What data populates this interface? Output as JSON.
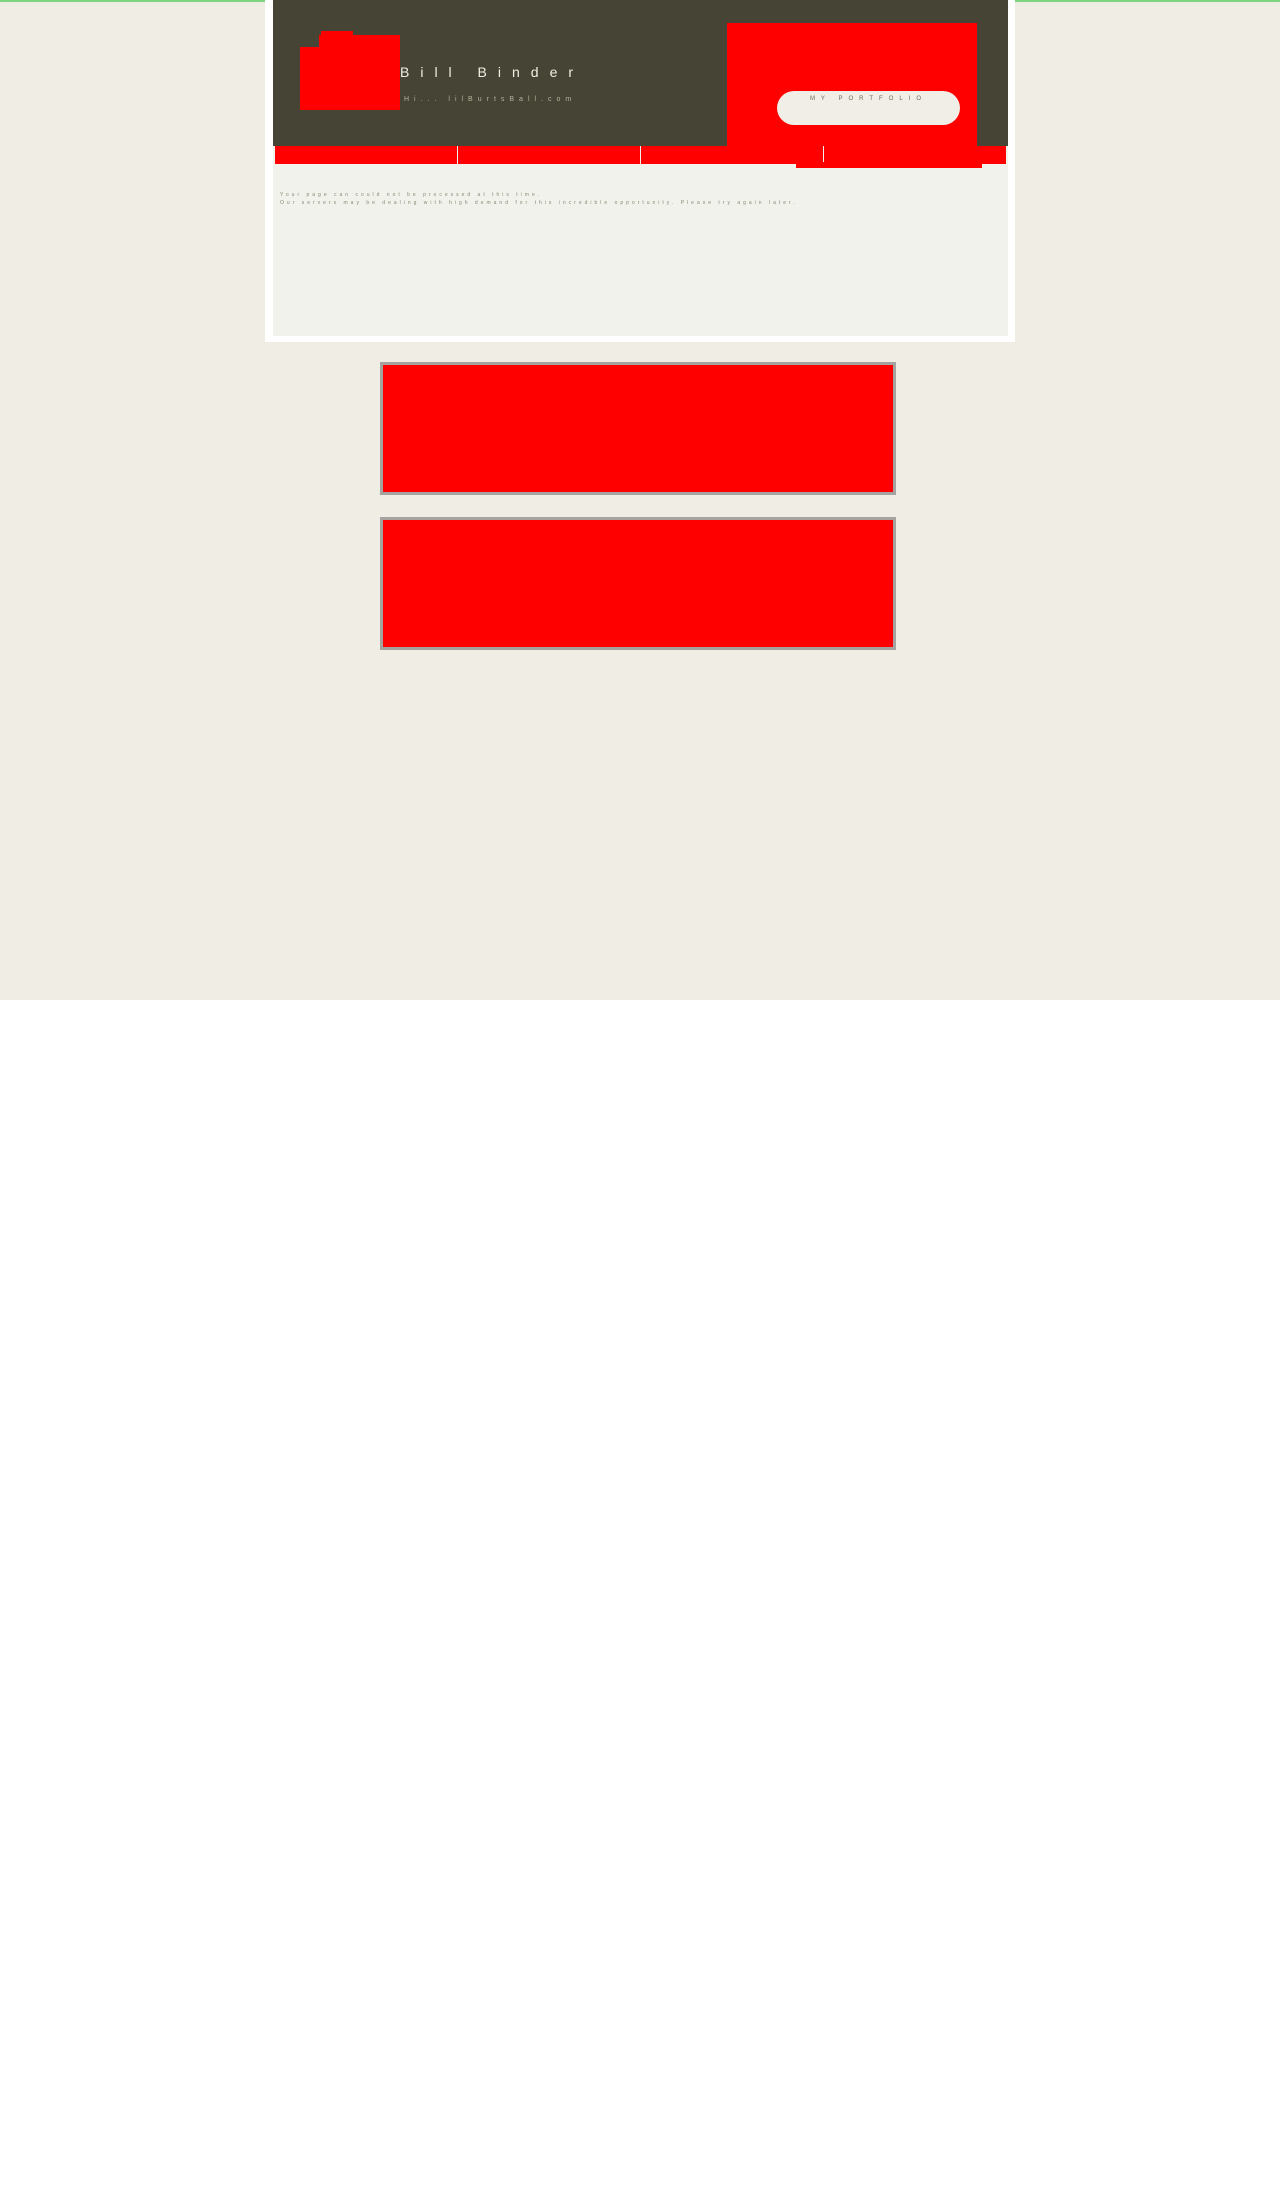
{
  "header": {
    "site_title": "Bill Binder",
    "site_subtitle": "Hi... lilBurtsBall.com",
    "portfolio_button": "MY PORTFOLIO"
  },
  "nav": {
    "items": [
      "",
      "",
      "",
      ""
    ]
  },
  "notice": {
    "line1": "Your page can could not be processed at this time.",
    "line2": "Our servers may be dealing with high demand for this incredible opportunity. Please try again later."
  },
  "colors": {
    "page_background": "#efede4",
    "header_background": "#464434",
    "accent": "#ff0000",
    "content_background": "#f2f2ec",
    "top_line": "#7fd57f"
  }
}
